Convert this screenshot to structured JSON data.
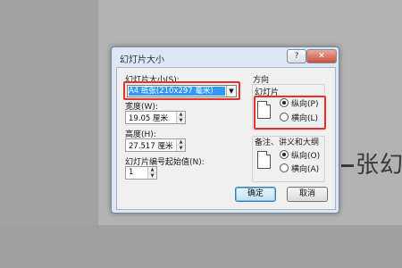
{
  "background": {
    "slide_text": "张幻"
  },
  "dialog": {
    "title": "幻灯片大小",
    "help_icon": "?",
    "close_icon": "✕",
    "slide_size": {
      "label": "幻灯片大小(S):",
      "selected": "A4 纸张(210x297 毫米)"
    },
    "width": {
      "label": "宽度(W):",
      "value": "19.05 厘米"
    },
    "height": {
      "label": "高度(H):",
      "value": "27.517 厘米"
    },
    "start_number": {
      "label": "幻灯片编号起始值(N):",
      "value": "1"
    },
    "orientation": {
      "title": "方向",
      "slides": {
        "title": "幻灯片",
        "portrait": "纵向(P)",
        "landscape": "横向(L)",
        "selected": "portrait"
      },
      "notes": {
        "title": "备注、讲义和大纲",
        "portrait": "纵向(O)",
        "landscape": "横向(A)",
        "selected": "portrait"
      }
    },
    "ok_label": "确定",
    "cancel_label": "取消"
  },
  "colors": {
    "highlight": "#e8312b",
    "selection": "#3399ff"
  }
}
